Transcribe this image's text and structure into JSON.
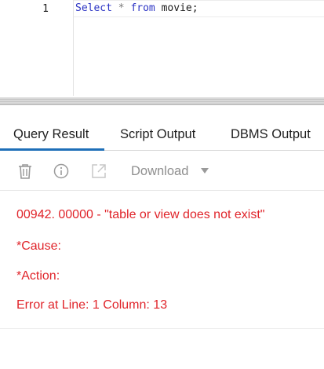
{
  "editor": {
    "line_number": "1",
    "code": {
      "keyword_select": "Select",
      "star": "*",
      "keyword_from": "from",
      "rest": "movie;"
    }
  },
  "tabs": [
    {
      "label": "Query Result",
      "active": true
    },
    {
      "label": "Script Output",
      "active": false
    },
    {
      "label": "DBMS Output",
      "active": false
    }
  ],
  "toolbar": {
    "icons": [
      "trash-icon",
      "info-icon",
      "export-icon"
    ],
    "download_label": "Download"
  },
  "messages": [
    "00942. 00000 -  \"table or view does not exist\"",
    "*Cause:",
    "*Action:",
    "Error at Line: 1 Column: 13"
  ],
  "colors": {
    "error_text": "#e0242a",
    "active_tab_underline": "#1e6fb8",
    "sql_keyword": "#2c34c4"
  }
}
